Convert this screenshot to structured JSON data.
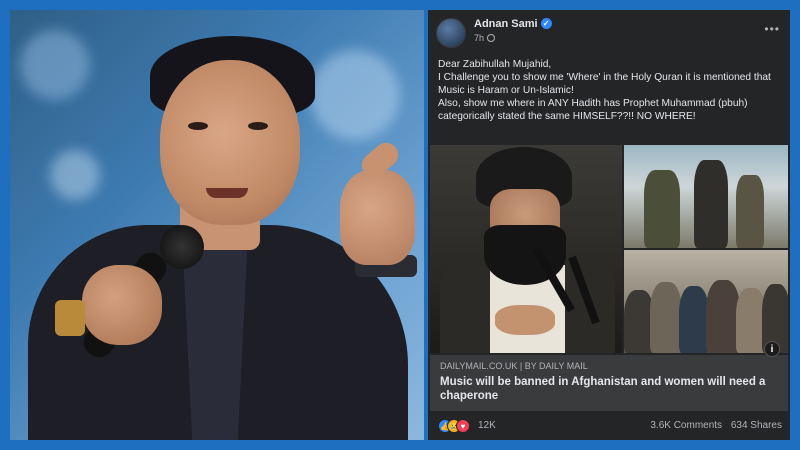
{
  "post": {
    "author": "Adnan Sami",
    "time": "7h",
    "verified_icon": "verified-icon",
    "body_lines": [
      "Dear Zabihullah Mujahid,",
      "I Challenge you to show me 'Where' in the Holy Quran it is mentioned that Music is Haram or Un-Islamic!",
      "Also, show me where in ANY Hadith has Prophet Muhammad (pbuh) categorically stated the same HIMSELF??!! NO WHERE!"
    ],
    "link": {
      "source": "DAILYMAIL.CO.UK | BY DAILY MAIL",
      "title": "Music will be banned in Afghanistan and women will need a chaperone",
      "info_glyph": "i"
    },
    "reactions": {
      "icons": [
        "like-icon",
        "sad-icon",
        "love-icon"
      ],
      "count": "12K"
    },
    "comments": "3.6K Comments",
    "shares": "634 Shares"
  },
  "colors": {
    "frame": "#1f6fc0",
    "panel_bg": "#242526",
    "link_bg": "#3a3b3c",
    "text": "#e4e6eb",
    "muted": "#b0b3b8",
    "verified": "#2d88ff"
  }
}
